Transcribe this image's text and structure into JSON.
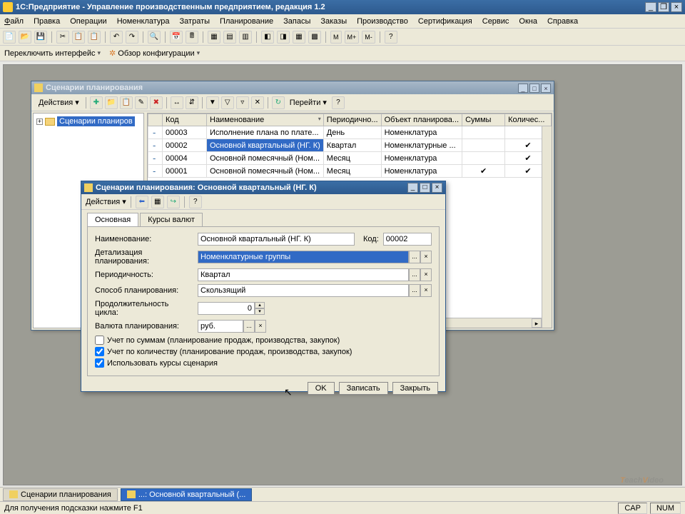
{
  "app": {
    "title": "1С:Предприятие - Управление производственным предприятием, редакция 1.2"
  },
  "menu": {
    "file": "Файл",
    "edit": "Правка",
    "operations": "Операции",
    "nomenclature": "Номенклатура",
    "costs": "Затраты",
    "planning": "Планирование",
    "stock": "Запасы",
    "orders": "Заказы",
    "production": "Производство",
    "cert": "Сертификация",
    "service": "Сервис",
    "windows": "Окна",
    "help": "Справка"
  },
  "subbar": {
    "switch": "Переключить интерфейс",
    "overview": "Обзор конфигурации"
  },
  "win1": {
    "title": "Сценарии планирования",
    "actions": "Действия",
    "goto": "Перейти",
    "tree_root": "Сценарии планиров",
    "cols": {
      "code": "Код",
      "name": "Наименование",
      "period": "Периодично...",
      "object": "Объект планирова...",
      "sums": "Суммы",
      "qty": "Количес..."
    },
    "rows": [
      {
        "code": "00003",
        "name": "Исполнение плана по плате...",
        "period": "День",
        "object": "Номенклатура",
        "sums": false,
        "qty": false
      },
      {
        "code": "00002",
        "name": "Основной квартальный (НГ. К)",
        "period": "Квартал",
        "object": "Номенклатурные ...",
        "sums": false,
        "qty": true
      },
      {
        "code": "00004",
        "name": "Основной помесячный (Ном...",
        "period": "Месяц",
        "object": "Номенклатура",
        "sums": false,
        "qty": true
      },
      {
        "code": "00001",
        "name": "Основной помесячный (Ном...",
        "period": "Месяц",
        "object": "Номенклатура",
        "sums": true,
        "qty": true
      }
    ]
  },
  "win2": {
    "title": "Сценарии планирования: Основной квартальный (НГ. К)",
    "actions": "Действия",
    "tabs": {
      "main": "Основная",
      "rates": "Курсы валют"
    },
    "labels": {
      "name": "Наименование:",
      "code": "Код:",
      "detail": "Детализация планирования:",
      "period": "Периодичность:",
      "method": "Способ планирования:",
      "duration": "Продолжительность цикла:",
      "currency": "Валюта планирования:"
    },
    "values": {
      "name": "Основной квартальный (НГ. К)",
      "code": "00002",
      "detail": "Номенклатурные группы",
      "period": "Квартал",
      "method": "Скользящий",
      "duration": "0",
      "currency": "руб."
    },
    "checks": {
      "sums": "Учет по суммам (планирование продаж, производства, закупок)",
      "qty": "Учет по количеству (планирование продаж, производства, закупок)",
      "rates": "Использовать курсы сценария"
    },
    "buttons": {
      "ok": "OK",
      "save": "Записать",
      "close": "Закрыть"
    }
  },
  "taskbar": {
    "t1": "Сценарии планирования",
    "t2": "...: Основной квартальный (..."
  },
  "status": {
    "hint": "Для получения подсказки нажмите F1",
    "cap": "CAP",
    "num": "NUM"
  },
  "watermark": {
    "t1": "each",
    "t2": "ideo"
  }
}
